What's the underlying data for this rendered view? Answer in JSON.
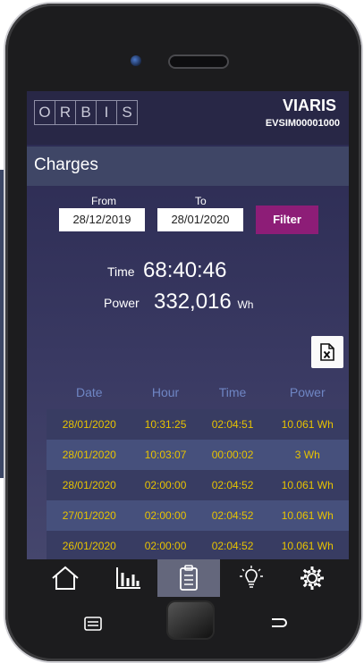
{
  "header": {
    "logo_letters": [
      "O",
      "R",
      "B",
      "I",
      "S"
    ],
    "brand": "VIARIS",
    "serial": "EVSIM00001000"
  },
  "page_title": "Charges",
  "filter": {
    "from_label": "From",
    "to_label": "To",
    "from_value": "28/12/2019",
    "to_value": "28/01/2020",
    "button_label": "Filter"
  },
  "summary": {
    "time_label": "Time",
    "time_value": "68:40:46",
    "power_label": "Power",
    "power_value": "332,016",
    "power_unit": "Wh"
  },
  "table": {
    "headers": [
      "Date",
      "Hour",
      "Time",
      "Power"
    ],
    "rows": [
      [
        "28/01/2020",
        "10:31:25",
        "02:04:51",
        "10.061 Wh"
      ],
      [
        "28/01/2020",
        "10:03:07",
        "00:00:02",
        "3 Wh"
      ],
      [
        "28/01/2020",
        "02:00:00",
        "02:04:52",
        "10.061 Wh"
      ],
      [
        "27/01/2020",
        "02:00:00",
        "02:04:52",
        "10.061 Wh"
      ],
      [
        "26/01/2020",
        "02:00:00",
        "02:04:52",
        "10.061 Wh"
      ]
    ]
  },
  "nav": [
    "home",
    "statistics",
    "charges",
    "lighting",
    "settings"
  ],
  "colors": {
    "accent": "#8d1d77",
    "table_value": "#e7c300",
    "table_header": "#6f86c4"
  }
}
